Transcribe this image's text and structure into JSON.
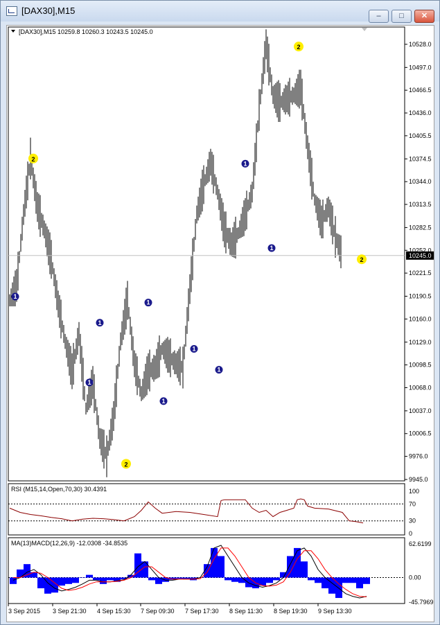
{
  "window": {
    "title": "[DAX30],M15",
    "minimize": "–",
    "maximize": "□",
    "close": "✕"
  },
  "main_panel": {
    "info": "[DAX30],M15  10259.8 10260.3 10243.5 10245.0",
    "price_ticks": [
      "10528.0",
      "10497.0",
      "10466.5",
      "10436.0",
      "10405.5",
      "10374.5",
      "10344.0",
      "10313.5",
      "10282.5",
      "10252.0",
      "10221.5",
      "10190.5",
      "10160.0",
      "10129.0",
      "10098.5",
      "10068.0",
      "10037.0",
      "10006.5",
      "9976.0",
      "9945.0"
    ],
    "current_price": "10245.0"
  },
  "rsi_panel": {
    "info": "RSI (M15,14,Open,70,30) 30.4391",
    "ticks": [
      "100",
      "70",
      "30",
      "0"
    ]
  },
  "macd_panel": {
    "info": "MA(13)MACD(12,26,9) -12.0308 -34.8535",
    "ticks": [
      "62.6199",
      "0.00",
      "-45.7969"
    ]
  },
  "time_ticks": [
    "3 Sep 2015",
    "3 Sep 21:30",
    "4 Sep 15:30",
    "7 Sep 09:30",
    "7 Sep 17:30",
    "8 Sep 11:30",
    "8 Sep 19:30",
    "9 Sep 13:30"
  ],
  "chart_data": [
    {
      "type": "line",
      "name": "[DAX30],M15 bars",
      "x": [
        0,
        10,
        20,
        30,
        40,
        50,
        60,
        70,
        80,
        90,
        100,
        110,
        120,
        130,
        140,
        150,
        160,
        170,
        180,
        190,
        200,
        210,
        220,
        230,
        240,
        250,
        260,
        270,
        280,
        290,
        300,
        310,
        320,
        330,
        340,
        350,
        360,
        370,
        380,
        390,
        400,
        410,
        420,
        430,
        440,
        450,
        460,
        470,
        480,
        490,
        500,
        510
      ],
      "y": [
        10185,
        10205,
        10300,
        10375,
        10310,
        10280,
        10240,
        10180,
        10130,
        10090,
        10140,
        10040,
        10075,
        10000,
        9976,
        10030,
        10130,
        10185,
        10100,
        10060,
        10090,
        10095,
        10120,
        10110,
        10100,
        10095,
        10200,
        10300,
        10340,
        10370,
        10330,
        10280,
        10260,
        10275,
        10300,
        10330,
        10440,
        10528,
        10460,
        10450,
        10455,
        10460,
        10470,
        10390,
        10320,
        10290,
        10310,
        10270,
        10245
      ],
      "ylim": [
        9945,
        10540
      ],
      "current_price": 10245.0,
      "markers": [
        {
          "x": 8,
          "y": 10190,
          "label": "1"
        },
        {
          "x": 34,
          "y": 10375,
          "label": "2"
        },
        {
          "x": 115,
          "y": 10075,
          "label": "1"
        },
        {
          "x": 130,
          "y": 10155,
          "label": "1"
        },
        {
          "x": 168,
          "y": 9966,
          "label": "2"
        },
        {
          "x": 200,
          "y": 10182,
          "label": "1"
        },
        {
          "x": 222,
          "y": 10050,
          "label": "1"
        },
        {
          "x": 266,
          "y": 10120,
          "label": "1"
        },
        {
          "x": 302,
          "y": 10092,
          "label": "1"
        },
        {
          "x": 340,
          "y": 10368,
          "label": "1"
        },
        {
          "x": 378,
          "y": 10255,
          "label": "1"
        },
        {
          "x": 417,
          "y": 10525,
          "label": "2"
        },
        {
          "x": 508,
          "y": 10240,
          "label": "2"
        }
      ]
    },
    {
      "type": "line",
      "name": "RSI (M15,14,Open,70,30)",
      "ylim": [
        0,
        100
      ],
      "levels": [
        70,
        30
      ],
      "x": [
        0,
        15,
        30,
        45,
        60,
        75,
        90,
        105,
        120,
        135,
        150,
        165,
        180,
        190,
        200,
        210,
        220,
        240,
        260,
        280,
        300,
        305,
        310,
        320,
        330,
        340,
        350,
        360,
        370,
        380,
        390,
        400,
        410,
        415,
        420,
        425,
        430,
        440,
        460,
        480,
        490,
        500,
        510
      ],
      "y": [
        60,
        50,
        45,
        42,
        38,
        35,
        30,
        34,
        36,
        35,
        33,
        30,
        40,
        55,
        75,
        60,
        48,
        52,
        50,
        45,
        40,
        78,
        80,
        80,
        80,
        80,
        60,
        50,
        55,
        40,
        50,
        55,
        60,
        80,
        82,
        80,
        65,
        60,
        58,
        50,
        30,
        28,
        25
      ]
    },
    {
      "type": "bar",
      "name": "MA(13)MACD(12,26,9)",
      "ylim": [
        -45.7969,
        62.6199
      ],
      "x": [
        0,
        10,
        20,
        30,
        40,
        50,
        60,
        70,
        80,
        90,
        100,
        110,
        120,
        130,
        140,
        150,
        160,
        170,
        180,
        190,
        200,
        210,
        220,
        230,
        240,
        250,
        260,
        270,
        280,
        290,
        300,
        310,
        320,
        330,
        340,
        350,
        360,
        370,
        380,
        390,
        400,
        410,
        420,
        430,
        440,
        450,
        460,
        470,
        480,
        490,
        500,
        510
      ],
      "values": [
        -12,
        15,
        25,
        10,
        -20,
        -30,
        -28,
        -15,
        -12,
        -10,
        0,
        5,
        -5,
        -12,
        -5,
        -8,
        -3,
        5,
        45,
        30,
        -5,
        -12,
        -8,
        -4,
        -2,
        -3,
        -5,
        0,
        25,
        55,
        40,
        -5,
        -8,
        -10,
        -18,
        -20,
        -15,
        -10,
        -5,
        10,
        40,
        55,
        30,
        -5,
        -10,
        -20,
        -30,
        -38,
        -10,
        -10,
        -20,
        -12
      ],
      "series": [
        {
          "name": "MACD",
          "values": [
            -5,
            0,
            10,
            15,
            5,
            -10,
            -20,
            -25,
            -22,
            -18,
            -12,
            -5,
            -5,
            -8,
            -8,
            -6,
            -4,
            5,
            20,
            30,
            15,
            0,
            -5,
            -5,
            -3,
            -3,
            -3,
            0,
            20,
            55,
            60,
            40,
            20,
            0,
            -10,
            -15,
            -18,
            -15,
            -10,
            0,
            25,
            50,
            55,
            40,
            15,
            0,
            -10,
            -20,
            -30,
            -35,
            -38,
            -35
          ]
        },
        {
          "name": "Signal",
          "values": [
            0,
            0,
            5,
            10,
            8,
            0,
            -10,
            -20,
            -24,
            -22,
            -18,
            -12,
            -8,
            -8,
            -8,
            -7,
            -5,
            0,
            10,
            20,
            20,
            10,
            0,
            -3,
            -3,
            -3,
            -3,
            -2,
            10,
            35,
            55,
            55,
            40,
            20,
            0,
            -10,
            -15,
            -16,
            -14,
            -8,
            10,
            35,
            50,
            50,
            35,
            15,
            0,
            -12,
            -22,
            -30,
            -35,
            -36
          ]
        }
      ]
    }
  ]
}
